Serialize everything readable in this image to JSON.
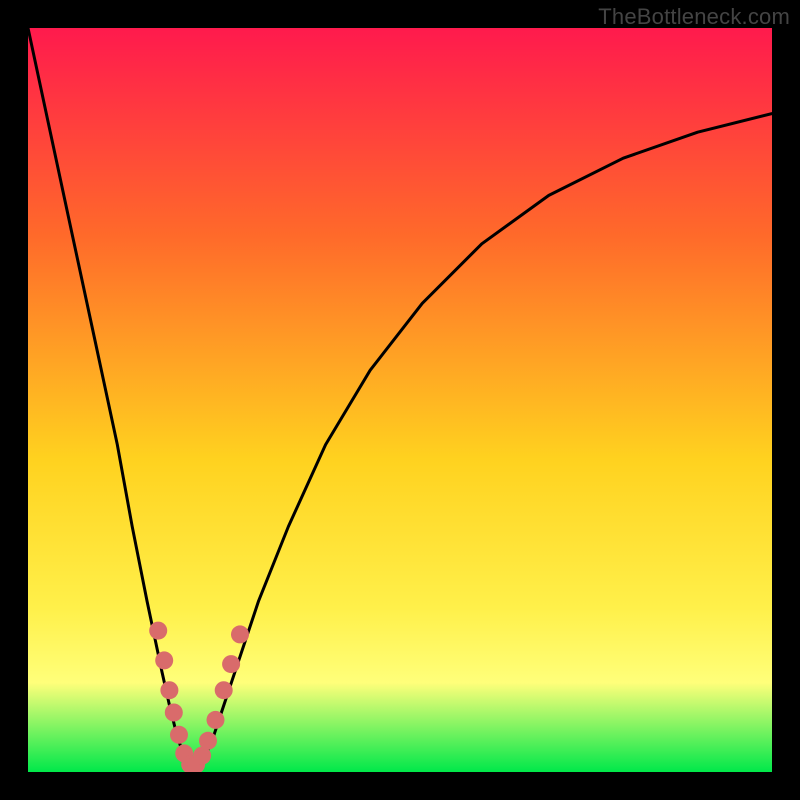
{
  "watermark": "TheBottleneck.com",
  "gradient": {
    "top": "#ff1a4d",
    "mid_upper": "#ff6a2a",
    "mid": "#ffd21f",
    "mid_lower": "#fff04a",
    "band": "#ffff7a",
    "bottom": "#00e84a"
  },
  "chart_data": {
    "type": "line",
    "title": "",
    "xlabel": "",
    "ylabel": "",
    "xlim": [
      0,
      100
    ],
    "ylim": [
      0,
      100
    ],
    "x_min_curve": 22,
    "series": [
      {
        "name": "curve",
        "x": [
          0,
          3,
          6,
          9,
          12,
          14,
          16,
          18,
          19,
          20,
          21,
          22,
          23,
          24,
          25,
          26,
          28,
          31,
          35,
          40,
          46,
          53,
          61,
          70,
          80,
          90,
          100
        ],
        "y": [
          100,
          86,
          72,
          58,
          44,
          33,
          23,
          13.5,
          9,
          5,
          2,
          0.5,
          0.8,
          2.5,
          5,
          8,
          14,
          23,
          33,
          44,
          54,
          63,
          71,
          77.5,
          82.5,
          86,
          88.5
        ]
      }
    ],
    "markers": {
      "name": "highlight-points",
      "color": "#d96b6b",
      "radius_px": 9,
      "points": [
        {
          "x": 17.5,
          "y": 19
        },
        {
          "x": 18.3,
          "y": 15
        },
        {
          "x": 19.0,
          "y": 11
        },
        {
          "x": 19.6,
          "y": 8
        },
        {
          "x": 20.3,
          "y": 5
        },
        {
          "x": 21.0,
          "y": 2.5
        },
        {
          "x": 21.8,
          "y": 1.0
        },
        {
          "x": 22.6,
          "y": 1.0
        },
        {
          "x": 23.4,
          "y": 2.2
        },
        {
          "x": 24.2,
          "y": 4.2
        },
        {
          "x": 25.2,
          "y": 7.0
        },
        {
          "x": 26.3,
          "y": 11.0
        },
        {
          "x": 27.3,
          "y": 14.5
        },
        {
          "x": 28.5,
          "y": 18.5
        }
      ]
    }
  }
}
